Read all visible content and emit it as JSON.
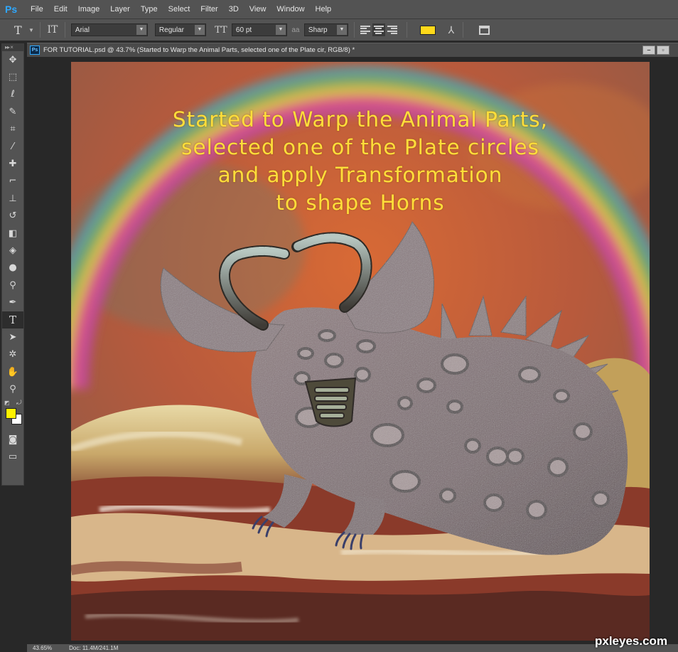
{
  "app": {
    "logo": "Ps",
    "menu": [
      "File",
      "Edit",
      "Image",
      "Layer",
      "Type",
      "Select",
      "Filter",
      "3D",
      "View",
      "Window",
      "Help"
    ]
  },
  "options_bar": {
    "tool_icon": "T",
    "orientation_icon": "IT",
    "font_family": "Arial",
    "font_style": "Regular",
    "font_size_icon": "TT",
    "font_size": "60 pt",
    "antialias_label": "aa",
    "antialias": "Sharp",
    "text_color": "#ffd91a",
    "icons": [
      "text-orientation-icon",
      "font-size-icon",
      "align-left-icon",
      "align-center-icon",
      "align-right-icon",
      "warp-text-icon",
      "character-panel-icon"
    ]
  },
  "toolbox": {
    "header": "▸▸ ×",
    "tools": [
      {
        "name": "move",
        "glyph": "✥"
      },
      {
        "name": "marquee",
        "glyph": "⬚"
      },
      {
        "name": "lasso",
        "glyph": "ℓ"
      },
      {
        "name": "quick-selection",
        "glyph": "✎"
      },
      {
        "name": "crop",
        "glyph": "⌗"
      },
      {
        "name": "eyedropper",
        "glyph": "⁄"
      },
      {
        "name": "healing-brush",
        "glyph": "✚"
      },
      {
        "name": "brush",
        "glyph": "⌐"
      },
      {
        "name": "clone-stamp",
        "glyph": "⊥"
      },
      {
        "name": "history-brush",
        "glyph": "↺"
      },
      {
        "name": "eraser",
        "glyph": "◧"
      },
      {
        "name": "paint-bucket",
        "glyph": "◈"
      },
      {
        "name": "blur",
        "glyph": "●"
      },
      {
        "name": "dodge",
        "glyph": "⚲"
      },
      {
        "name": "pen",
        "glyph": "✒"
      },
      {
        "name": "type",
        "glyph": "T"
      },
      {
        "name": "path-selection",
        "glyph": "➤"
      },
      {
        "name": "custom-shape",
        "glyph": "✲"
      },
      {
        "name": "hand",
        "glyph": "✋"
      },
      {
        "name": "zoom",
        "glyph": "⚲"
      }
    ],
    "active_tool": "type",
    "foreground_color": "#fff200",
    "background_color": "#ffffff",
    "bottom_icons": [
      "quick-mask-icon",
      "screen-mode-icon"
    ]
  },
  "document": {
    "title": "FOR TUTORIAL.psd @ 43.7% (Started to Warp the Animal Parts, selected one of the Plate cir, RGB/8) *",
    "window_buttons": [
      "minimize",
      "restore"
    ],
    "zoom": "43.65%",
    "doc_size": "Doc: 11.4M/241.1M"
  },
  "canvas": {
    "caption_lines": [
      "Started to Warp the Animal Parts,",
      "selected one of the Plate circles",
      "and apply Transformation",
      "to shape Horns"
    ],
    "caption_color": "#ffde3a",
    "watermark": "pxleyes.com"
  }
}
